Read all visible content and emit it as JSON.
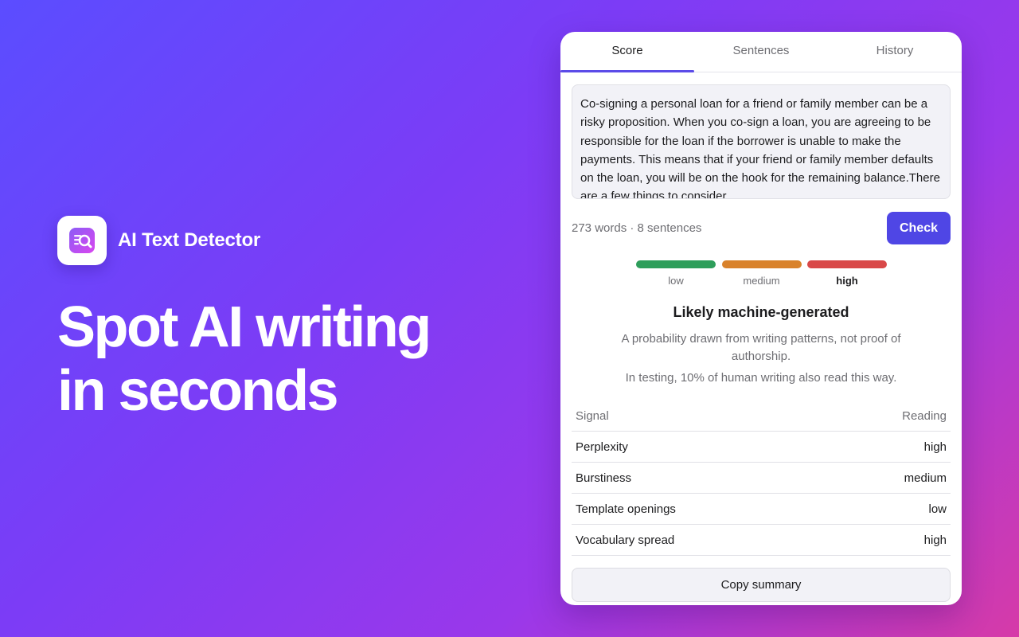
{
  "brand": {
    "app_name": "AI Text Detector",
    "icon": "doc-magnifier-icon"
  },
  "headline": {
    "line1": "Spot AI writing",
    "line2": "in seconds"
  },
  "tabs": [
    {
      "label": "Score",
      "active": true
    },
    {
      "label": "Sentences",
      "active": false
    },
    {
      "label": "History",
      "active": false
    }
  ],
  "input": {
    "text": "Co-signing a personal loan for a friend or family member can be a risky proposition. When you co-sign a loan, you are agreeing to be responsible for the loan if the borrower is unable to make the payments. This means that if your friend or family member defaults on the loan, you will be on the hook for the remaining balance.There are a few things to consider"
  },
  "meta": {
    "count": "273 words · 8 sentences",
    "check_label": "Check"
  },
  "scale": {
    "levels": [
      {
        "label": "low",
        "color": "#2e9e5b"
      },
      {
        "label": "medium",
        "color": "#d9822b"
      },
      {
        "label": "high",
        "color": "#d94848"
      }
    ],
    "current": "high"
  },
  "result": {
    "verdict": "Likely machine-generated",
    "disclaimer": "A probability drawn from writing patterns, not proof of authorship.",
    "stat": "In testing, 10% of human writing also read this way."
  },
  "signals": {
    "header": {
      "signal": "Signal",
      "reading": "Reading"
    },
    "rows": [
      {
        "signal": "Perplexity",
        "reading": "high"
      },
      {
        "signal": "Burstiness",
        "reading": "medium"
      },
      {
        "signal": "Template openings",
        "reading": "low"
      },
      {
        "signal": "Vocabulary spread",
        "reading": "high"
      }
    ]
  },
  "copy_label": "Copy summary",
  "colors": {
    "accent": "#4f46e5",
    "background_start": "#5b4dff",
    "background_end": "#d63aa8"
  }
}
